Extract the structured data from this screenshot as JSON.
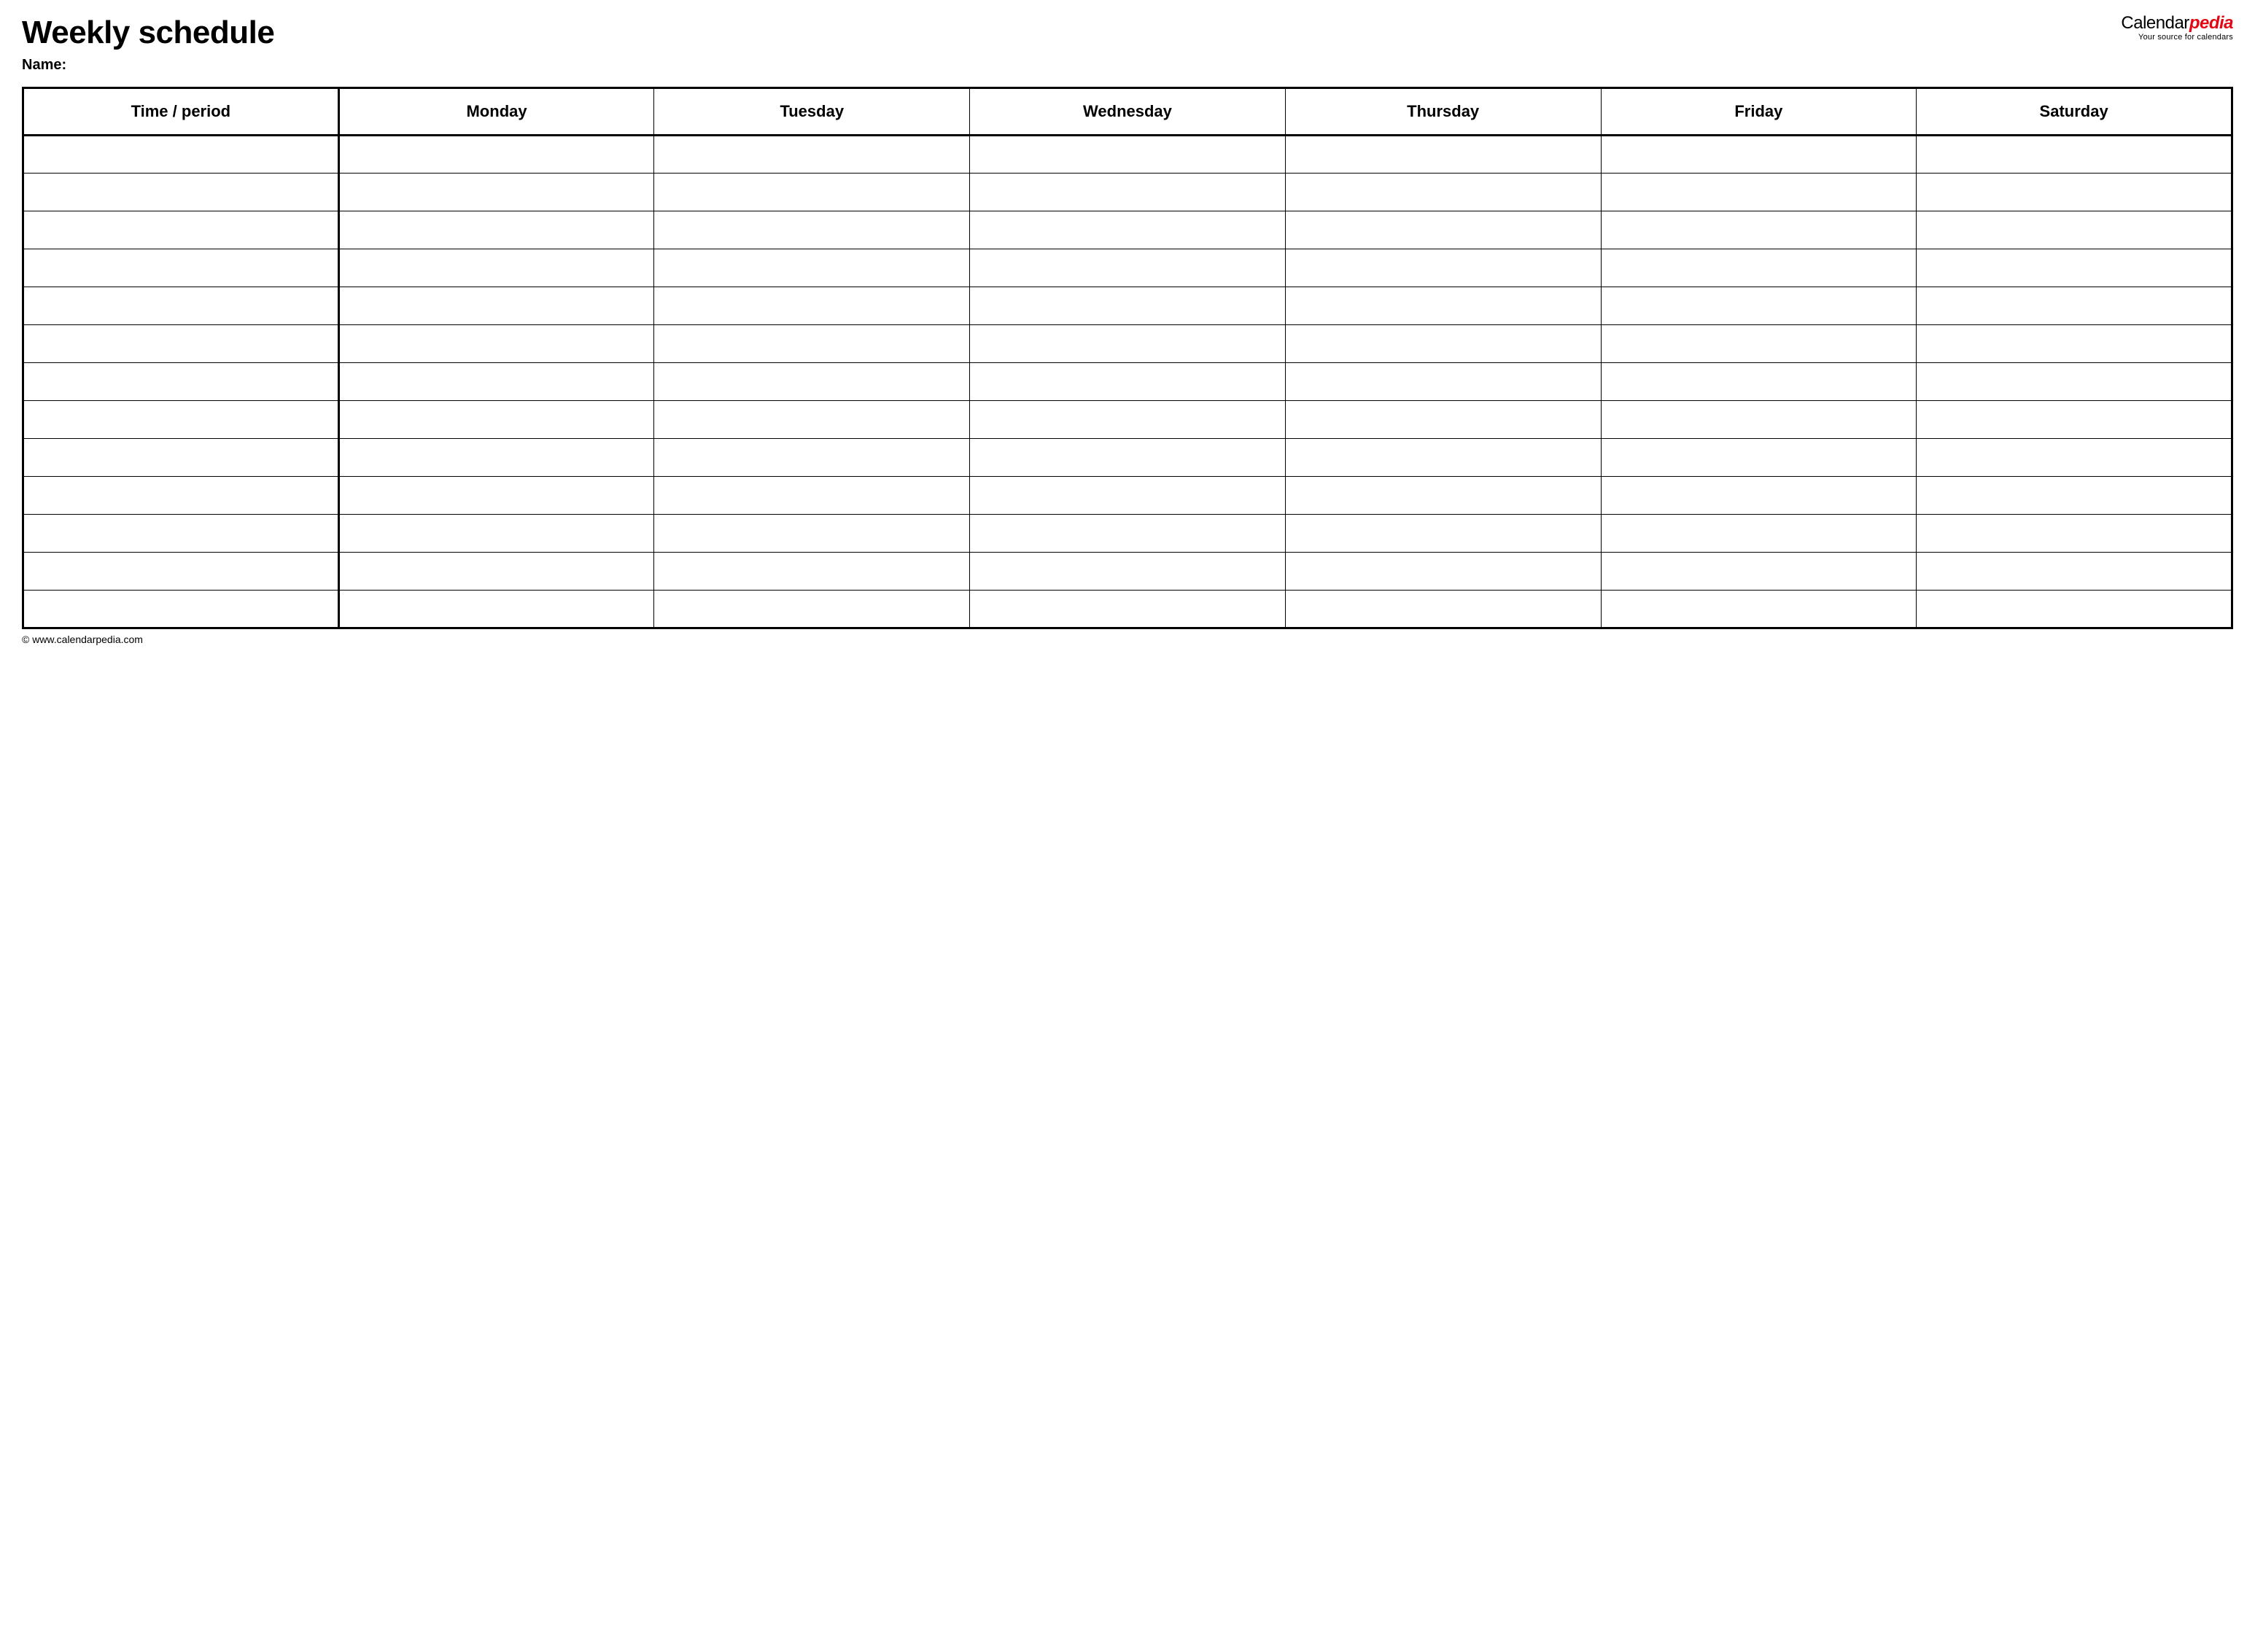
{
  "title": "Weekly schedule",
  "name_label": "Name:",
  "logo": {
    "prefix": "Calendar",
    "suffix": "pedia",
    "tagline": "Your source for calendars"
  },
  "columns": [
    "Time / period",
    "Monday",
    "Tuesday",
    "Wednesday",
    "Thursday",
    "Friday",
    "Saturday"
  ],
  "row_count": 13,
  "footer": "© www.calendarpedia.com"
}
